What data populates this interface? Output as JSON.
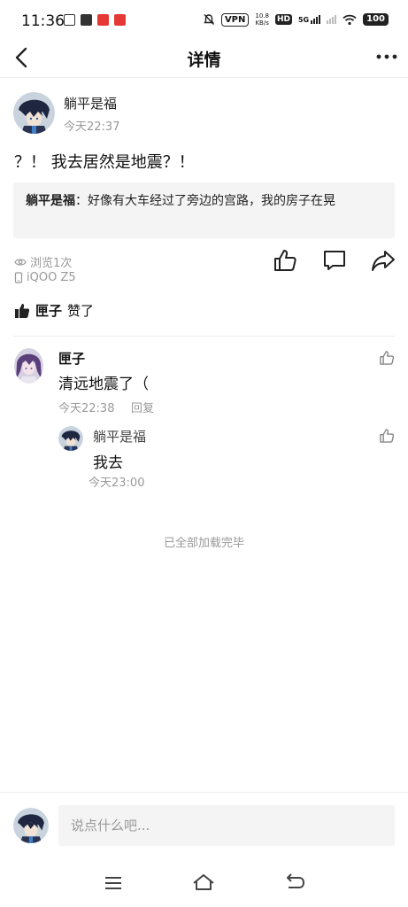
{
  "status_bar": {
    "time": "11:36",
    "vpn": "VPN",
    "net_speed_value": "10.8",
    "net_speed_unit": "KB/s",
    "hd": "HD",
    "signal_5g": "5G",
    "battery": "100"
  },
  "header": {
    "title": "详情"
  },
  "post": {
    "author": "躺平是福",
    "time": "今天22:37",
    "text": "？！ 我去居然是地震？！",
    "quote_author": "躺平是福",
    "quote_sep": "：",
    "quote_text": "好像有大车经过了旁边的宫路，我的房子在晃",
    "views": "浏览1次",
    "device": "iQOO Z5"
  },
  "likes": {
    "user": "匣子",
    "suffix": "赞了"
  },
  "comments": [
    {
      "name": "匣子",
      "text": "清远地震了（",
      "time": "今天22:38",
      "reply_label": "回复",
      "replies": [
        {
          "name": "躺平是福",
          "text": "我去",
          "time": "今天23:00"
        }
      ]
    }
  ],
  "footer_note": "已全部加载完毕",
  "input": {
    "placeholder": "说点什么吧..."
  },
  "colors": {
    "text_primary": "#111111",
    "text_secondary": "#999999",
    "quote_bg": "#f4f4f4",
    "divider": "#eeeeee"
  },
  "icons": [
    "back-arrow-icon",
    "more-dots-icon",
    "eye-icon",
    "phone-icon",
    "thumb-up-icon",
    "comment-icon",
    "share-icon",
    "menu-icon",
    "home-icon",
    "return-icon"
  ]
}
